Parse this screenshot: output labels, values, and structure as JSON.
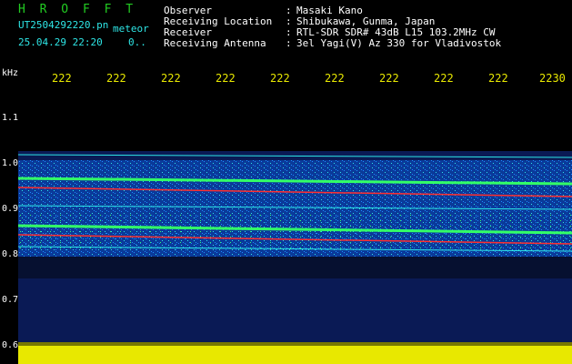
{
  "header": {
    "title": "H R O F F T",
    "filename": "UT2504292220.pn",
    "mode": "meteor",
    "datetime": "25.04.29 22:20",
    "count": "0..",
    "fields": [
      {
        "label": "Observer",
        "value": "Masaki Kano"
      },
      {
        "label": "Receiving Location",
        "value": "Shibukawa, Gunma, Japan"
      },
      {
        "label": "Receiver",
        "value": "RTL-SDR SDR# 43dB L15 103.2MHz CW"
      },
      {
        "label": "Receiving Antenna",
        "value": "3el Yagi(V) Az 330 for Vladivostok"
      }
    ],
    "colon": ":"
  },
  "axis": {
    "unit": "kHz",
    "y_ticks": [
      "1.1",
      "1.0",
      "0.9",
      "0.8",
      "0.7",
      "0.6"
    ],
    "x_ticks": [
      "222",
      "222",
      "222",
      "222",
      "222",
      "222",
      "222",
      "222",
      "222",
      "2230"
    ]
  },
  "colors": {
    "background": "#000000",
    "title": "#22cc22",
    "text": "#ffffff",
    "axis_label": "#e8e800",
    "band_noise": "#0a3a9a",
    "band_speckle": "#1e8cff",
    "signal_line": "#ff3030",
    "bottom_bar": "#e8e800"
  }
}
